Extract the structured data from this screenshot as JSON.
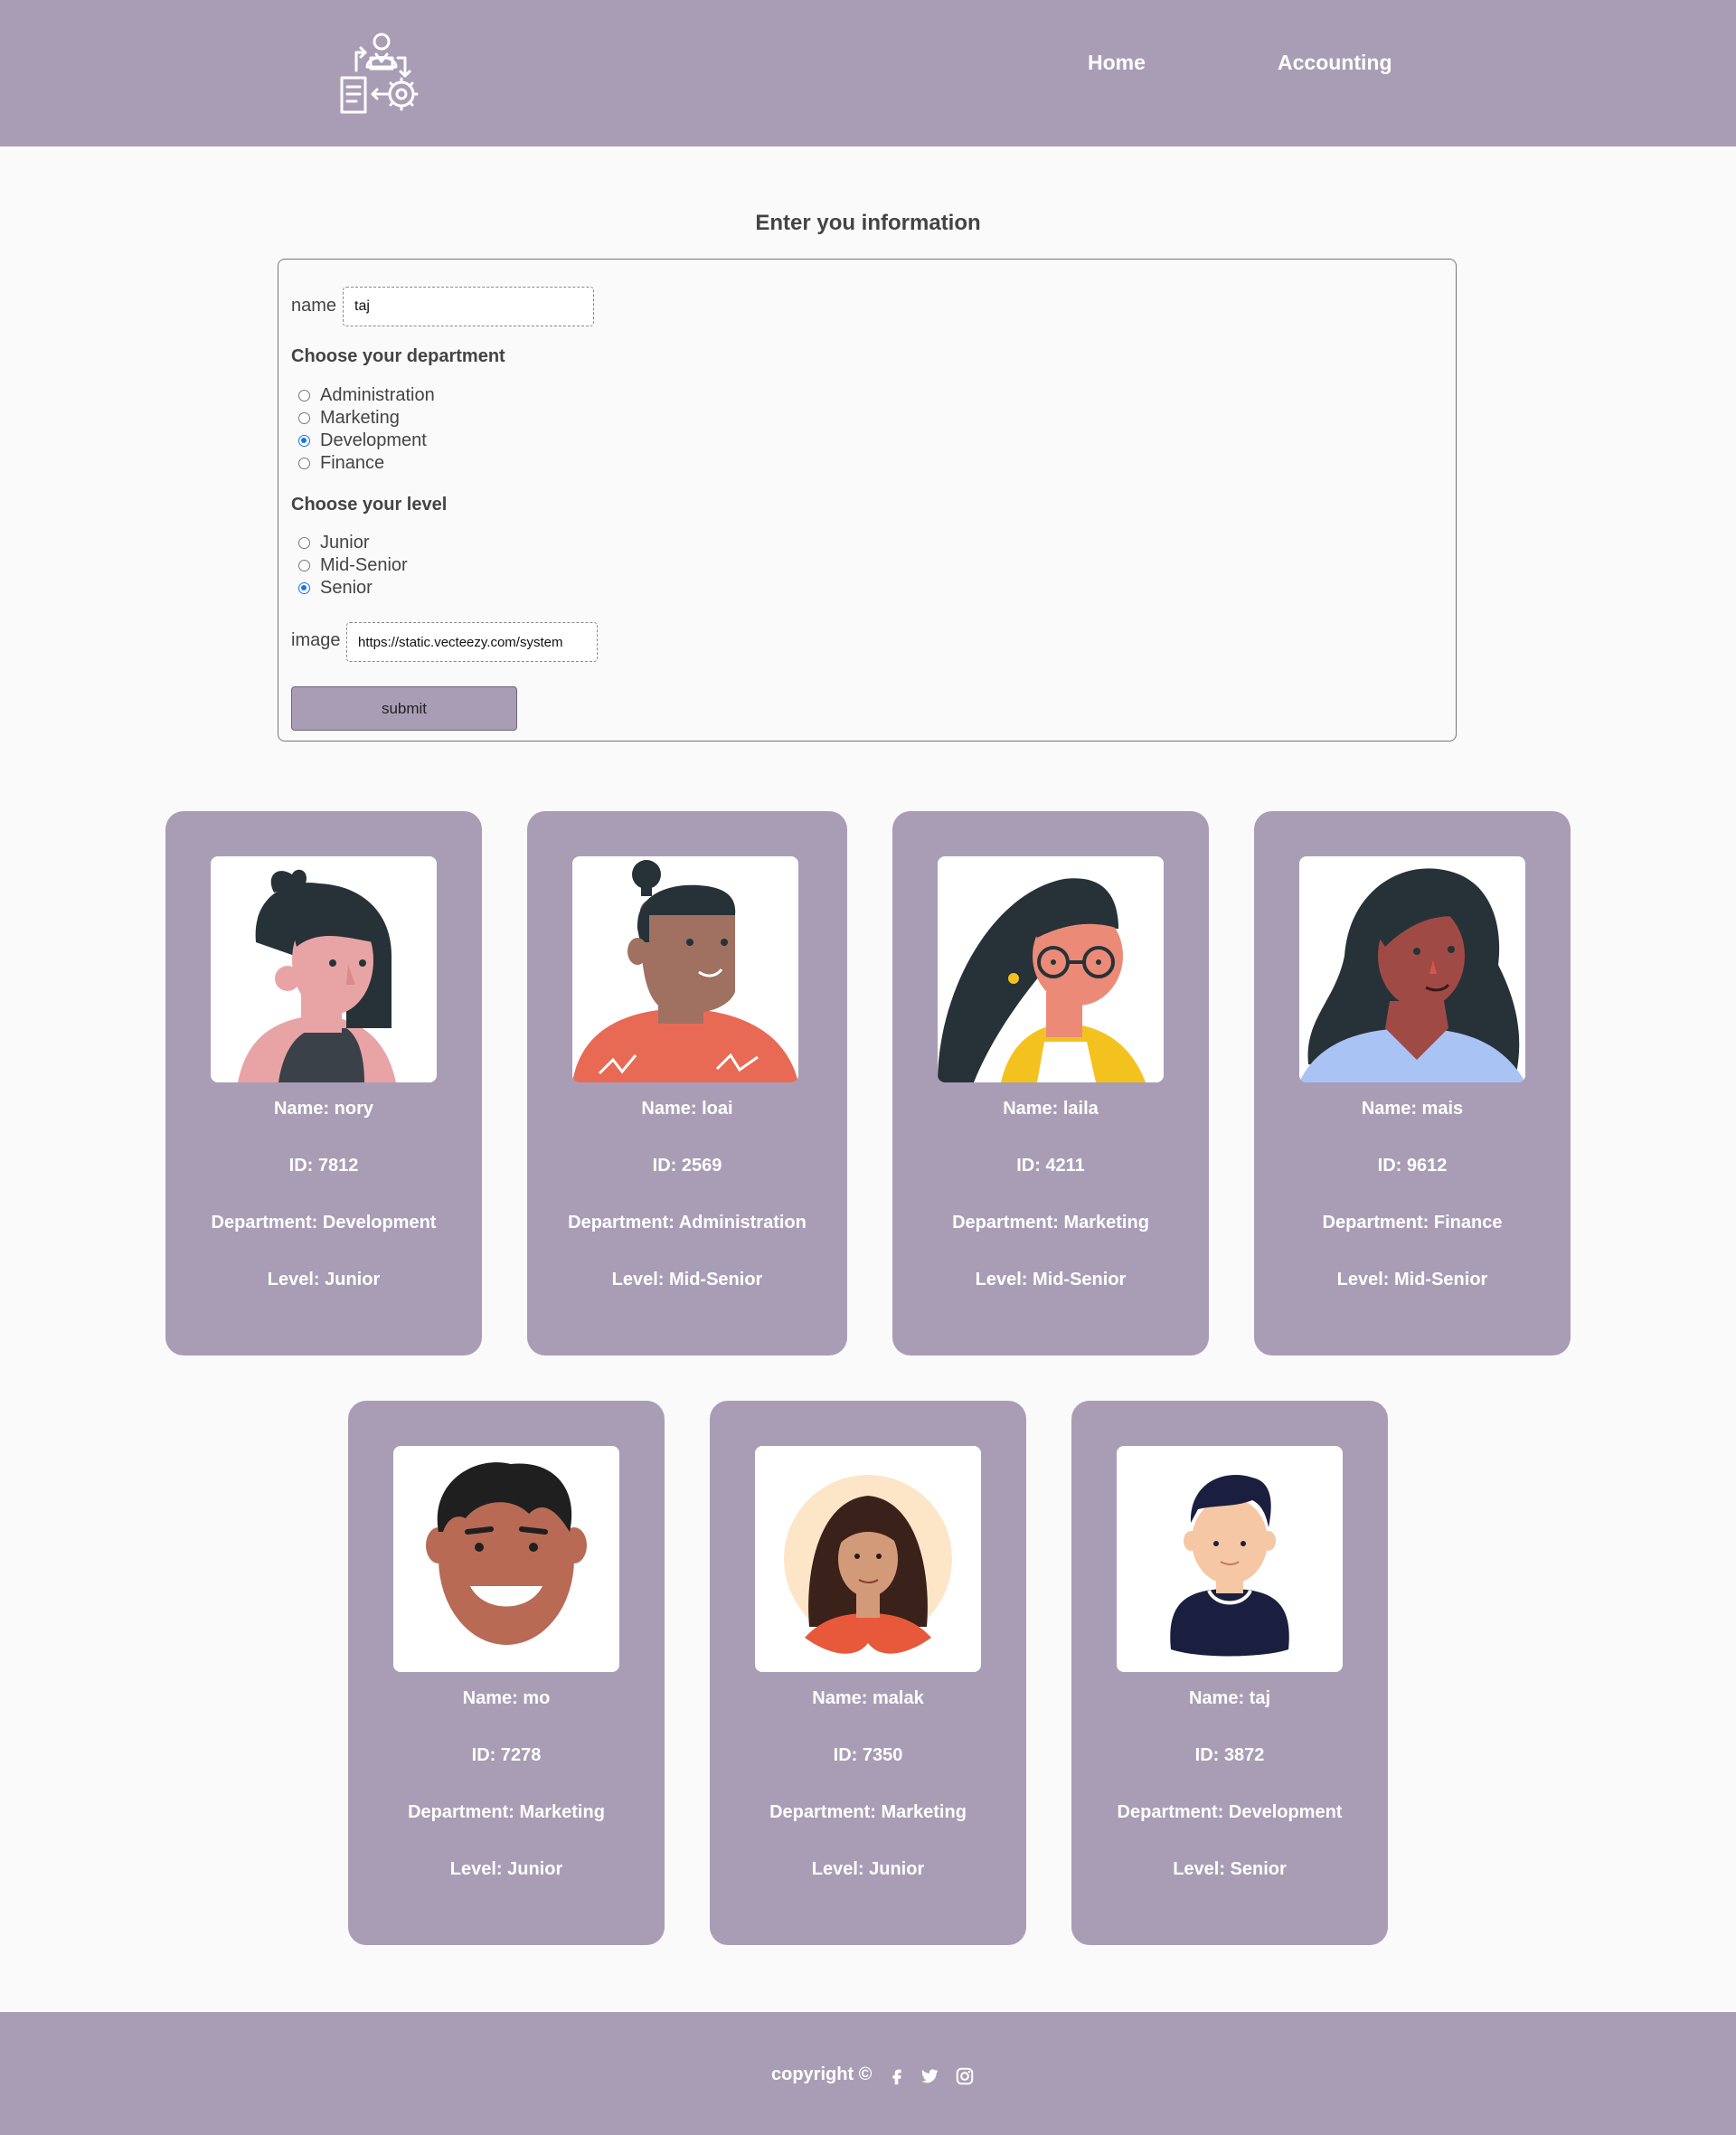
{
  "nav": {
    "home": "Home",
    "accounting": "Accounting"
  },
  "icons": {
    "logo": "employee-management-icon"
  },
  "form": {
    "title": "Enter you information",
    "name_label": "name",
    "name_value": "taj",
    "department_heading": "Choose your department",
    "departments": [
      "Administration",
      "Marketing",
      "Development",
      "Finance"
    ],
    "selected_department": "Development",
    "level_heading": "Choose your level",
    "levels": [
      "Junior",
      "Mid-Senior",
      "Senior"
    ],
    "selected_level": "Senior",
    "image_label": "image",
    "image_value": "https://static.vecteezy.com/system",
    "submit": "submit"
  },
  "employees": [
    {
      "name": "Name: nory",
      "id": "ID: 7812",
      "department": "Department: Development",
      "level": "Level: Junior"
    },
    {
      "name": "Name: loai",
      "id": "ID: 2569",
      "department": "Department: Administration",
      "level": "Level: Mid-Senior"
    },
    {
      "name": "Name: laila",
      "id": "ID: 4211",
      "department": "Department: Marketing",
      "level": "Level: Mid-Senior"
    },
    {
      "name": "Name: mais",
      "id": "ID: 9612",
      "department": "Department: Finance",
      "level": "Level: Mid-Senior"
    },
    {
      "name": "Name: mo",
      "id": "ID: 7278",
      "department": "Department: Marketing",
      "level": "Level: Junior"
    },
    {
      "name": "Name: malak",
      "id": "ID: 7350",
      "department": "Department: Marketing",
      "level": "Level: Junior"
    },
    {
      "name": "Name: taj",
      "id": "ID: 3872",
      "department": "Department: Development",
      "level": "Level: Senior"
    }
  ],
  "footer": {
    "copyright": "copyright ©",
    "social_icons": [
      "facebook-icon",
      "twitter-icon",
      "instagram-icon"
    ]
  },
  "colors": {
    "brand": "#a99db6",
    "background": "#fafafa",
    "radio_checked": "#1a73e8"
  }
}
